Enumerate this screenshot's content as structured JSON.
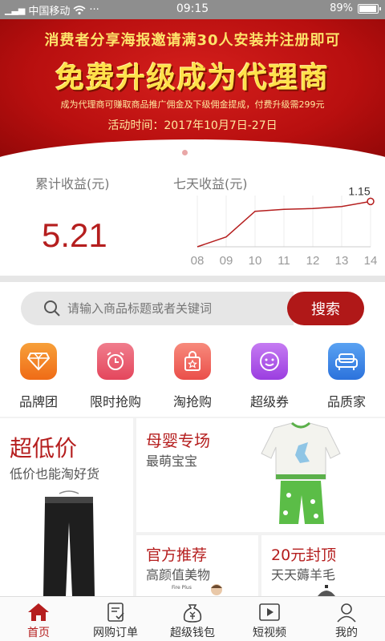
{
  "status_bar": {
    "carrier": "中国移动",
    "time": "09:15",
    "battery": "89%",
    "more": "···"
  },
  "banner": {
    "line1": "消费者分享海报邀请满30人安装并注册即可",
    "line2": "免费升级成为代理商",
    "line3": "成为代理商可赚取商品推广佣金及下级佣金提成，付费升级需299元",
    "line4": "活动时间：2017年10月7日-27日",
    "slides": 2,
    "active_slide": 2
  },
  "earnings": {
    "total_label": "累计收益(元)",
    "total_value": "5.21",
    "week_label": "七天收益(元)"
  },
  "chart_data": {
    "type": "line",
    "categories": [
      "08",
      "09",
      "10",
      "11",
      "12",
      "13",
      "14"
    ],
    "values": [
      0.0,
      0.25,
      0.9,
      0.95,
      0.97,
      1.02,
      1.15
    ],
    "data_labels": [
      "",
      "",
      "",
      "",
      "",
      "",
      "1.15"
    ],
    "ylim": [
      0,
      1.3
    ],
    "grid": true,
    "color": "#b51e1e"
  },
  "search": {
    "placeholder": "请输入商品标题或者关键词",
    "button_label": "搜索"
  },
  "categories": [
    {
      "label": "品牌团",
      "icon": "diamond-icon",
      "color": "#f07a1c"
    },
    {
      "label": "限时抢购",
      "icon": "alarm-clock-icon",
      "color": "#e8536a"
    },
    {
      "label": "淘抢购",
      "icon": "shopping-bag-icon",
      "color": "#ef5d57"
    },
    {
      "label": "超级券",
      "icon": "smiley-coupon-icon",
      "color": "#b04ee0"
    },
    {
      "label": "品质家",
      "icon": "sofa-icon",
      "color": "#3b86e8"
    }
  ],
  "tiles": {
    "cheap": {
      "title": "超低价",
      "subtitle": "低价也能淘好货"
    },
    "baby": {
      "title": "母婴专场",
      "subtitle": "最萌宝宝"
    },
    "official": {
      "title": "官方推荐",
      "subtitle": "高颜值美物",
      "brand_text": "Fire Plus"
    },
    "twenty": {
      "title": "20元封顶",
      "subtitle": "天天薅羊毛"
    }
  },
  "tabbar": [
    {
      "label": "首页",
      "icon": "home-icon",
      "active": true
    },
    {
      "label": "网购订单",
      "icon": "order-icon",
      "active": false
    },
    {
      "label": "超级钱包",
      "icon": "money-bag-icon",
      "active": false
    },
    {
      "label": "短视频",
      "icon": "video-icon",
      "active": false
    },
    {
      "label": "我的",
      "icon": "user-icon",
      "active": false
    }
  ]
}
